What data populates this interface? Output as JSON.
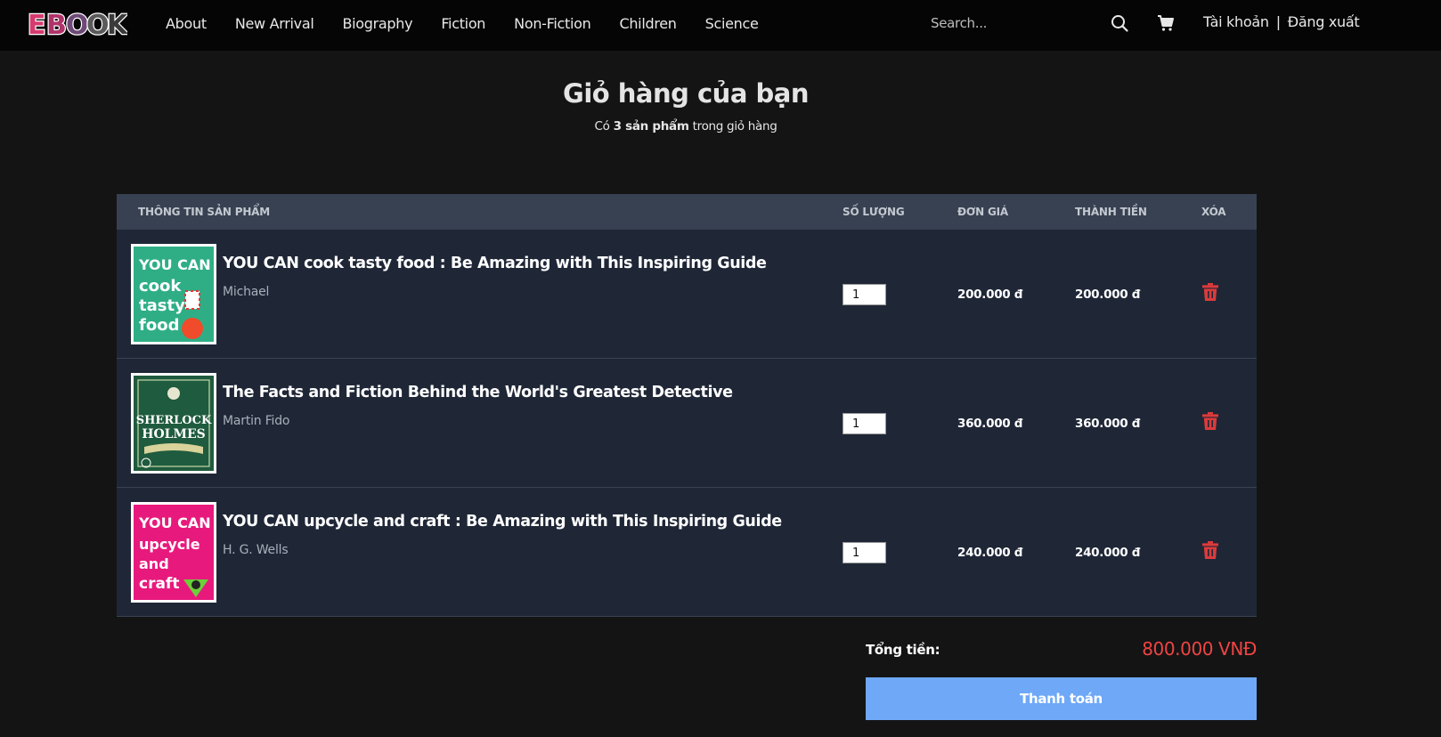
{
  "brand": {
    "logo_text": "EBOOK"
  },
  "nav": {
    "links": [
      "About",
      "New Arrival",
      "Biography",
      "Fiction",
      "Non-Fiction",
      "Children",
      "Science"
    ],
    "search_placeholder": "Search...",
    "account_label": "Tài khoản",
    "separator": "|",
    "logout_label": "Đăng xuất"
  },
  "header": {
    "title": "Giỏ hàng của bạn",
    "subtitle_prefix": "Có",
    "subtitle_count": "3 sản phẩm",
    "subtitle_suffix": "trong giỏ hàng"
  },
  "table": {
    "headers": {
      "product": "THÔNG TIN SẢN PHẨM",
      "quantity": "SỐ LƯỢNG",
      "unit_price": "ĐƠN GIÁ",
      "subtotal": "THÀNH TIỀN",
      "delete": "XÓA"
    },
    "items": [
      {
        "title": "YOU CAN cook tasty food : Be Amazing with This Inspiring Guide",
        "author": "Michael",
        "quantity": "1",
        "unit_price": "200.000 đ",
        "subtotal": "200.000 đ",
        "cover_text": [
          "YOU CAN",
          "cook",
          "tasty",
          "food"
        ],
        "cover_color": "#2fae86"
      },
      {
        "title": "The Facts and Fiction Behind the World's Greatest Detective",
        "author": "Martin Fido",
        "quantity": "1",
        "unit_price": "360.000 đ",
        "subtotal": "360.000 đ",
        "cover_text": [
          "SHERLOCK",
          "HOLMES"
        ],
        "cover_color": "#1f5b3e"
      },
      {
        "title": "YOU CAN upcycle and craft : Be Amazing with This Inspiring Guide",
        "author": "H. G. Wells",
        "quantity": "1",
        "unit_price": "240.000 đ",
        "subtotal": "240.000 đ",
        "cover_text": [
          "YOU CAN",
          "upcycle",
          "and",
          "craft"
        ],
        "cover_color": "#e8197d"
      }
    ]
  },
  "summary": {
    "total_label": "Tổng tiền:",
    "total_value": "800.000 VNĐ",
    "checkout_label": "Thanh toán"
  },
  "colors": {
    "accent": "#6ea8f7",
    "danger": "#ef4444",
    "table_bg": "#1f2737",
    "table_header_bg": "#374151"
  }
}
